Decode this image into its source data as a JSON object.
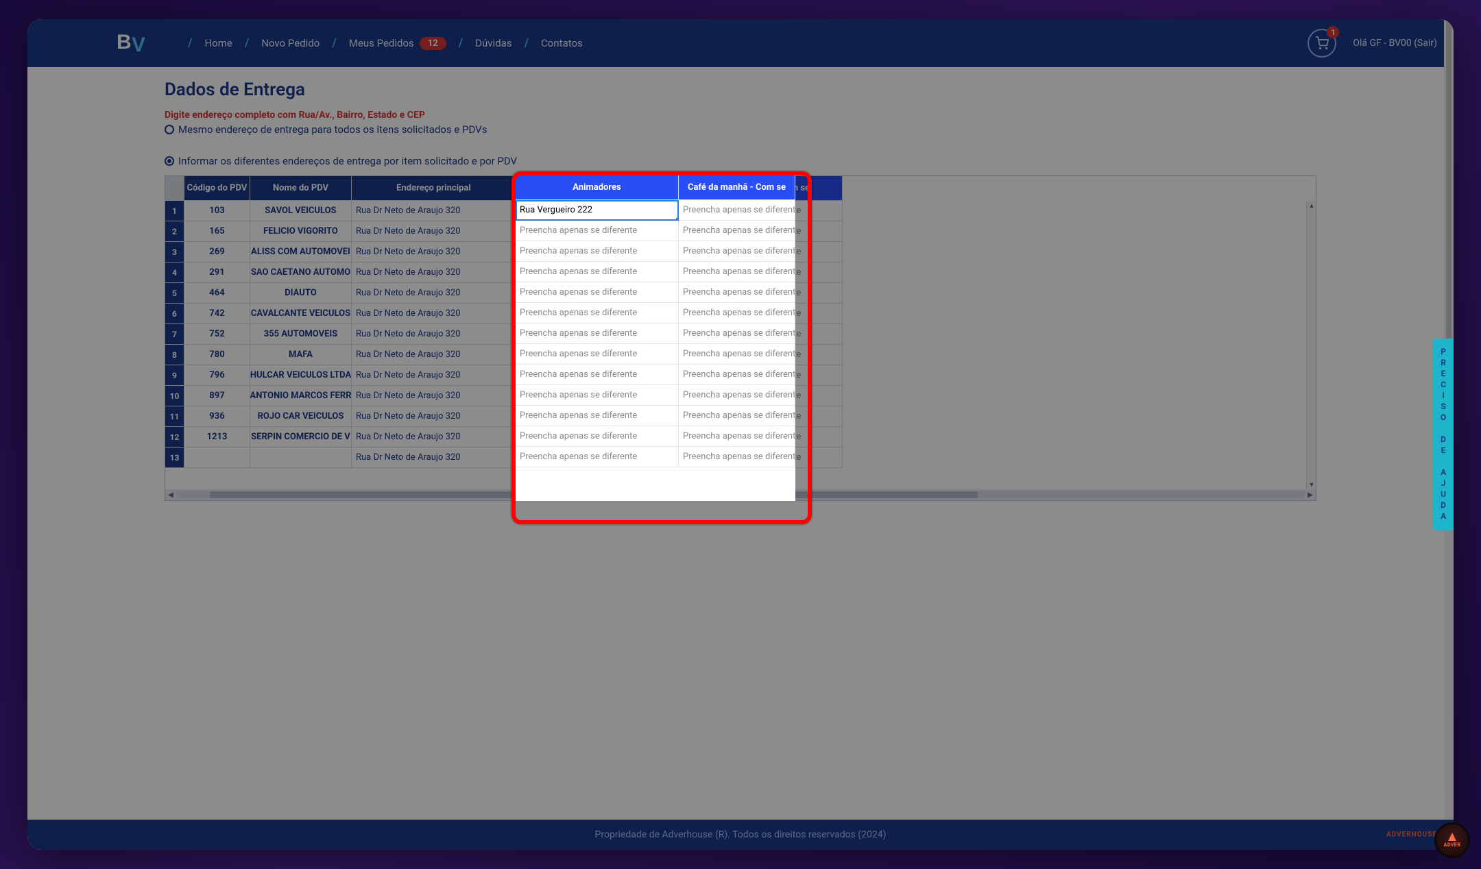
{
  "nav": {
    "home": "Home",
    "novo_pedido": "Novo Pedido",
    "meus_pedidos": "Meus Pedidos",
    "meus_pedidos_badge": "12",
    "duvidas": "Dúvidas",
    "contatos": "Contatos"
  },
  "cart": {
    "count": "1"
  },
  "greeting": "Olá GF - BV00 (Sair)",
  "page": {
    "title": "Dados de Entrega",
    "warn": "Digite endereço completo com Rua/Av., Bairro, Estado e CEP",
    "radio_same": "Mesmo endereço de entrega para todos os itens solicitados e PDVs",
    "radio_diff": "Informar os diferentes endereços de entrega por item solicitado e por PDV"
  },
  "grid": {
    "headers": {
      "codigo": "Código do PDV",
      "nome": "Nome do PDV",
      "endereco": "Endereço principal",
      "col1": "Animadores",
      "col2": "Café da manhã - Com se"
    },
    "placeholder": "Preencha apenas se diferente",
    "active_value": "Rua Vergueiro 222",
    "default_address": "Rua Dr Neto de Araujo 320",
    "rows": [
      {
        "n": "1",
        "codigo": "103",
        "nome": "SAVOL VEICULOS"
      },
      {
        "n": "2",
        "codigo": "165",
        "nome": "FELICIO VIGORITO"
      },
      {
        "n": "3",
        "codigo": "269",
        "nome": "ALISS COM AUTOMOVEI"
      },
      {
        "n": "4",
        "codigo": "291",
        "nome": "SAO CAETANO AUTOMO"
      },
      {
        "n": "5",
        "codigo": "464",
        "nome": "DIAUTO"
      },
      {
        "n": "6",
        "codigo": "742",
        "nome": "CAVALCANTE VEICULOS"
      },
      {
        "n": "7",
        "codigo": "752",
        "nome": "355 AUTOMOVEIS"
      },
      {
        "n": "8",
        "codigo": "780",
        "nome": "MAFA"
      },
      {
        "n": "9",
        "codigo": "796",
        "nome": "HULCAR VEICULOS LTDA"
      },
      {
        "n": "10",
        "codigo": "897",
        "nome": "ANTONIO MARCOS FERR"
      },
      {
        "n": "11",
        "codigo": "936",
        "nome": "ROJO CAR VEICULOS"
      },
      {
        "n": "12",
        "codigo": "1213",
        "nome": "SERPIN COMERCIO DE V"
      },
      {
        "n": "13",
        "codigo": "",
        "nome": ""
      }
    ]
  },
  "footer": "Propriedade de Adverhouse (R). Todos os direitos reservados (2024)",
  "footer_brand": "ADVERHOUSE",
  "help_tab": "PRECISO DE AJUDA",
  "corner_brand": "ADVER"
}
